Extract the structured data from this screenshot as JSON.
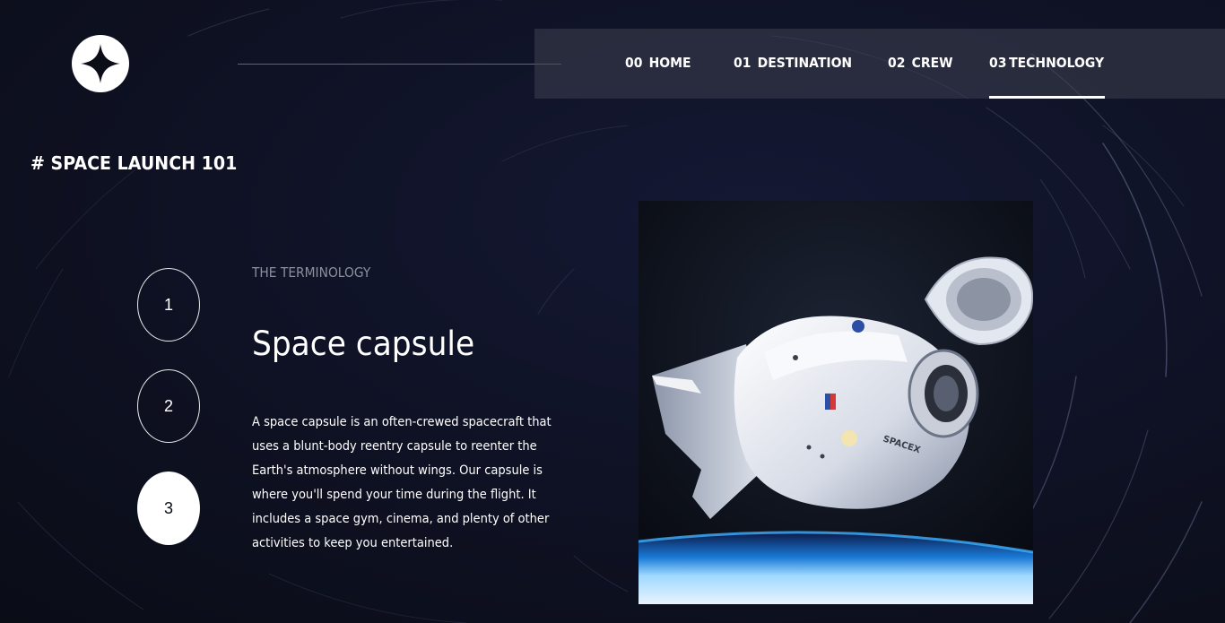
{
  "colors": {
    "background": "#0b0d17",
    "nav_background": "rgba(60,64,78,0.55)",
    "muted_text": "#8d8f9c",
    "text": "#ffffff"
  },
  "logo": {
    "icon": "four-point-star-icon"
  },
  "nav": {
    "items": [
      {
        "num": "00",
        "label": "HOME"
      },
      {
        "num": "01",
        "label": "DESTINATION"
      },
      {
        "num": "02",
        "label": "CREW"
      },
      {
        "num": "03",
        "label": "TECHNOLOGY",
        "active": true
      }
    ]
  },
  "page": {
    "heading": "# SPACE LAUNCH 101"
  },
  "steps": [
    {
      "label": "1",
      "active": false
    },
    {
      "label": "2",
      "active": false
    },
    {
      "label": "3",
      "active": true
    }
  ],
  "tech": {
    "eyebrow": "THE TERMINOLOGY",
    "title": "Space capsule",
    "description": "A space capsule is an often-crewed spacecraft that uses a blunt-body reentry capsule to reenter the Earth's atmosphere without wings. Our capsule is where you'll spend your time during the flight. It includes a space gym, cinema, and plenty of other activities to keep you entertained.",
    "image": "space-capsule-photo",
    "image_label": "SPACEX"
  }
}
